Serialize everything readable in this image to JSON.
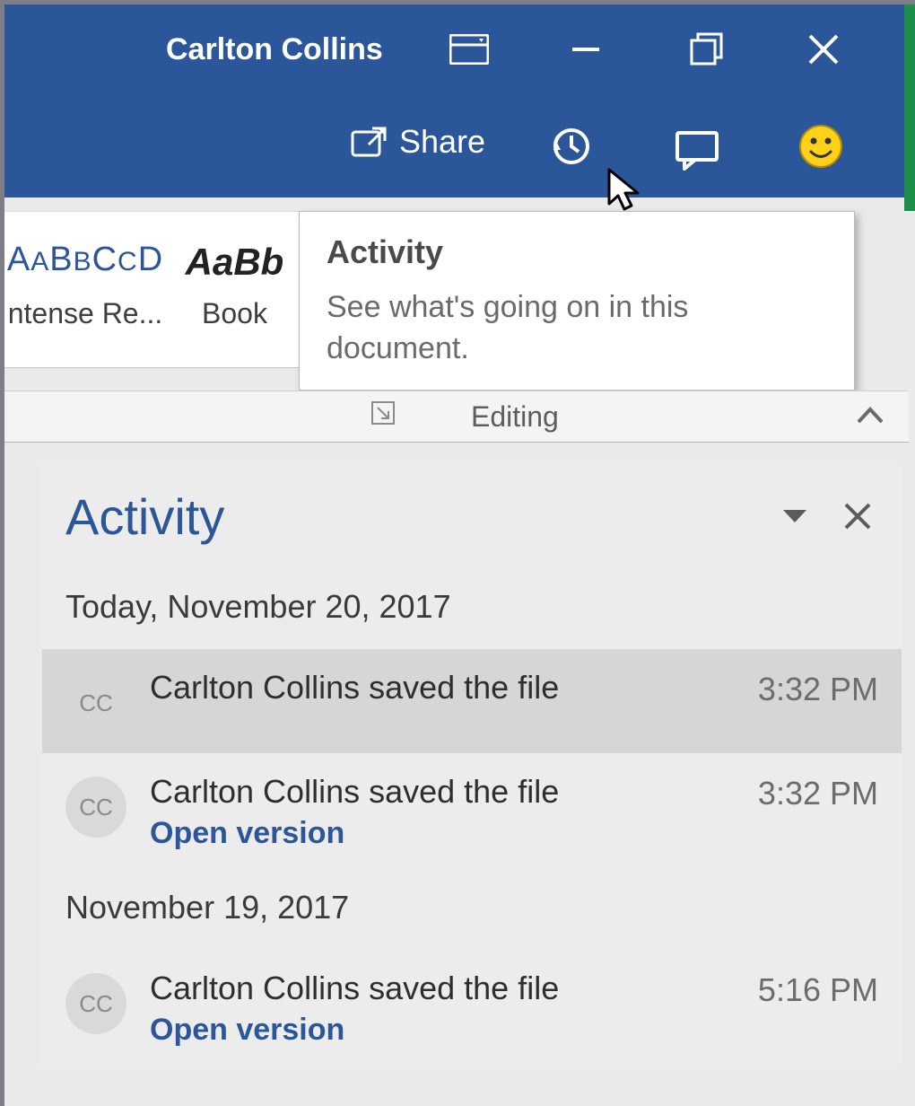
{
  "titlebar": {
    "user": "Carlton Collins"
  },
  "ribbon": {
    "share_label": "Share",
    "styles": [
      {
        "sample": "AaBbCcD",
        "label": "ntense Re..."
      },
      {
        "sample": "AaBb",
        "label": "Book "
      }
    ]
  },
  "tooltip": {
    "title": "Activity",
    "body": "See what's going on in this document."
  },
  "subrow": {
    "group_label": "Editing"
  },
  "pane": {
    "title": "Activity",
    "sections": [
      {
        "date": "Today, November 20, 2017",
        "items": [
          {
            "initials": "CC",
            "text": "Carlton Collins saved the file",
            "time": "3:32 PM",
            "selected": true,
            "has_link": false
          },
          {
            "initials": "CC",
            "text": "Carlton Collins saved the file",
            "time": "3:32 PM",
            "link": "Open version"
          }
        ]
      },
      {
        "date": "November 19, 2017",
        "items": [
          {
            "initials": "CC",
            "text": "Carlton Collins saved the file",
            "time": "5:16 PM",
            "link": "Open version"
          }
        ]
      }
    ]
  }
}
